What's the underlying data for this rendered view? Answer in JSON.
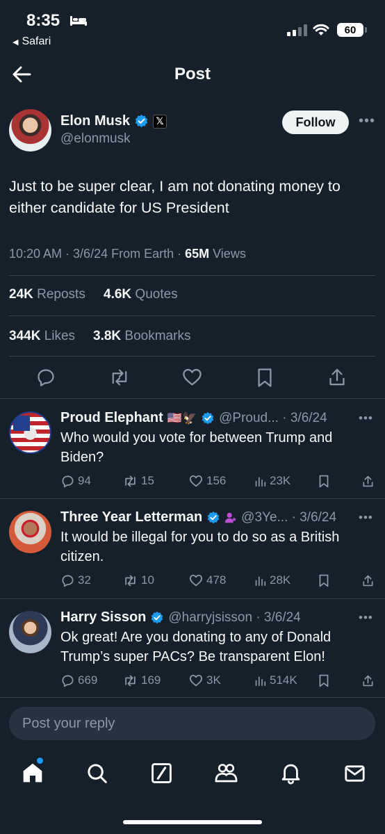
{
  "status_bar": {
    "time": "8:35",
    "back_app": "Safari",
    "battery": "60"
  },
  "header": {
    "title": "Post"
  },
  "post": {
    "author_name": "Elon Musk",
    "author_handle": "@elonmusk",
    "follow_label": "Follow",
    "text": "Just to be super clear, I am not donating money to either candidate for US President",
    "meta_time": "10:20 AM · 3/6/24 From Earth · ",
    "views_count": "65M",
    "views_label": " Views",
    "reposts_count": "24K",
    "reposts_label": " Reposts",
    "quotes_count": "4.6K",
    "quotes_label": " Quotes",
    "likes_count": "344K",
    "likes_label": " Likes",
    "bookmarks_count": "3.8K",
    "bookmarks_label": " Bookmarks"
  },
  "replies": [
    {
      "name": "Proud Elephant",
      "emoji": "🇺🇸🦅",
      "handle": "@Proud... · 3/6/24",
      "text": "Who would you vote for between Trump and Biden?",
      "replies": "94",
      "reposts": "15",
      "likes": "156",
      "views": "23K"
    },
    {
      "name": "Three Year Letterman",
      "handle": "@3Ye... · 3/6/24",
      "text": "It would be illegal for you to do so as a British citizen.",
      "replies": "32",
      "reposts": "10",
      "likes": "478",
      "views": "28K"
    },
    {
      "name": "Harry Sisson",
      "handle": "@harryjsisson · 3/6/24",
      "text": "Ok great! Are you donating to any of Donald Trump’s super PACs? Be transparent Elon!",
      "replies": "669",
      "reposts": "169",
      "likes": "3K",
      "views": "514K"
    }
  ],
  "reply_box": {
    "placeholder": "Post your reply"
  },
  "colors": {
    "background": "#15202b",
    "accent": "#1d9bf0",
    "muted": "#8b98a5",
    "divider": "#38444d"
  },
  "icons": [
    "bed-icon",
    "back-arrow-icon",
    "verified-icon",
    "x-badge-icon",
    "more-icon",
    "reply-icon",
    "repost-icon",
    "like-icon",
    "bookmark-icon",
    "share-icon",
    "views-icon",
    "home-icon",
    "search-icon",
    "grok-icon",
    "communities-icon",
    "notifications-icon",
    "messages-icon"
  ]
}
